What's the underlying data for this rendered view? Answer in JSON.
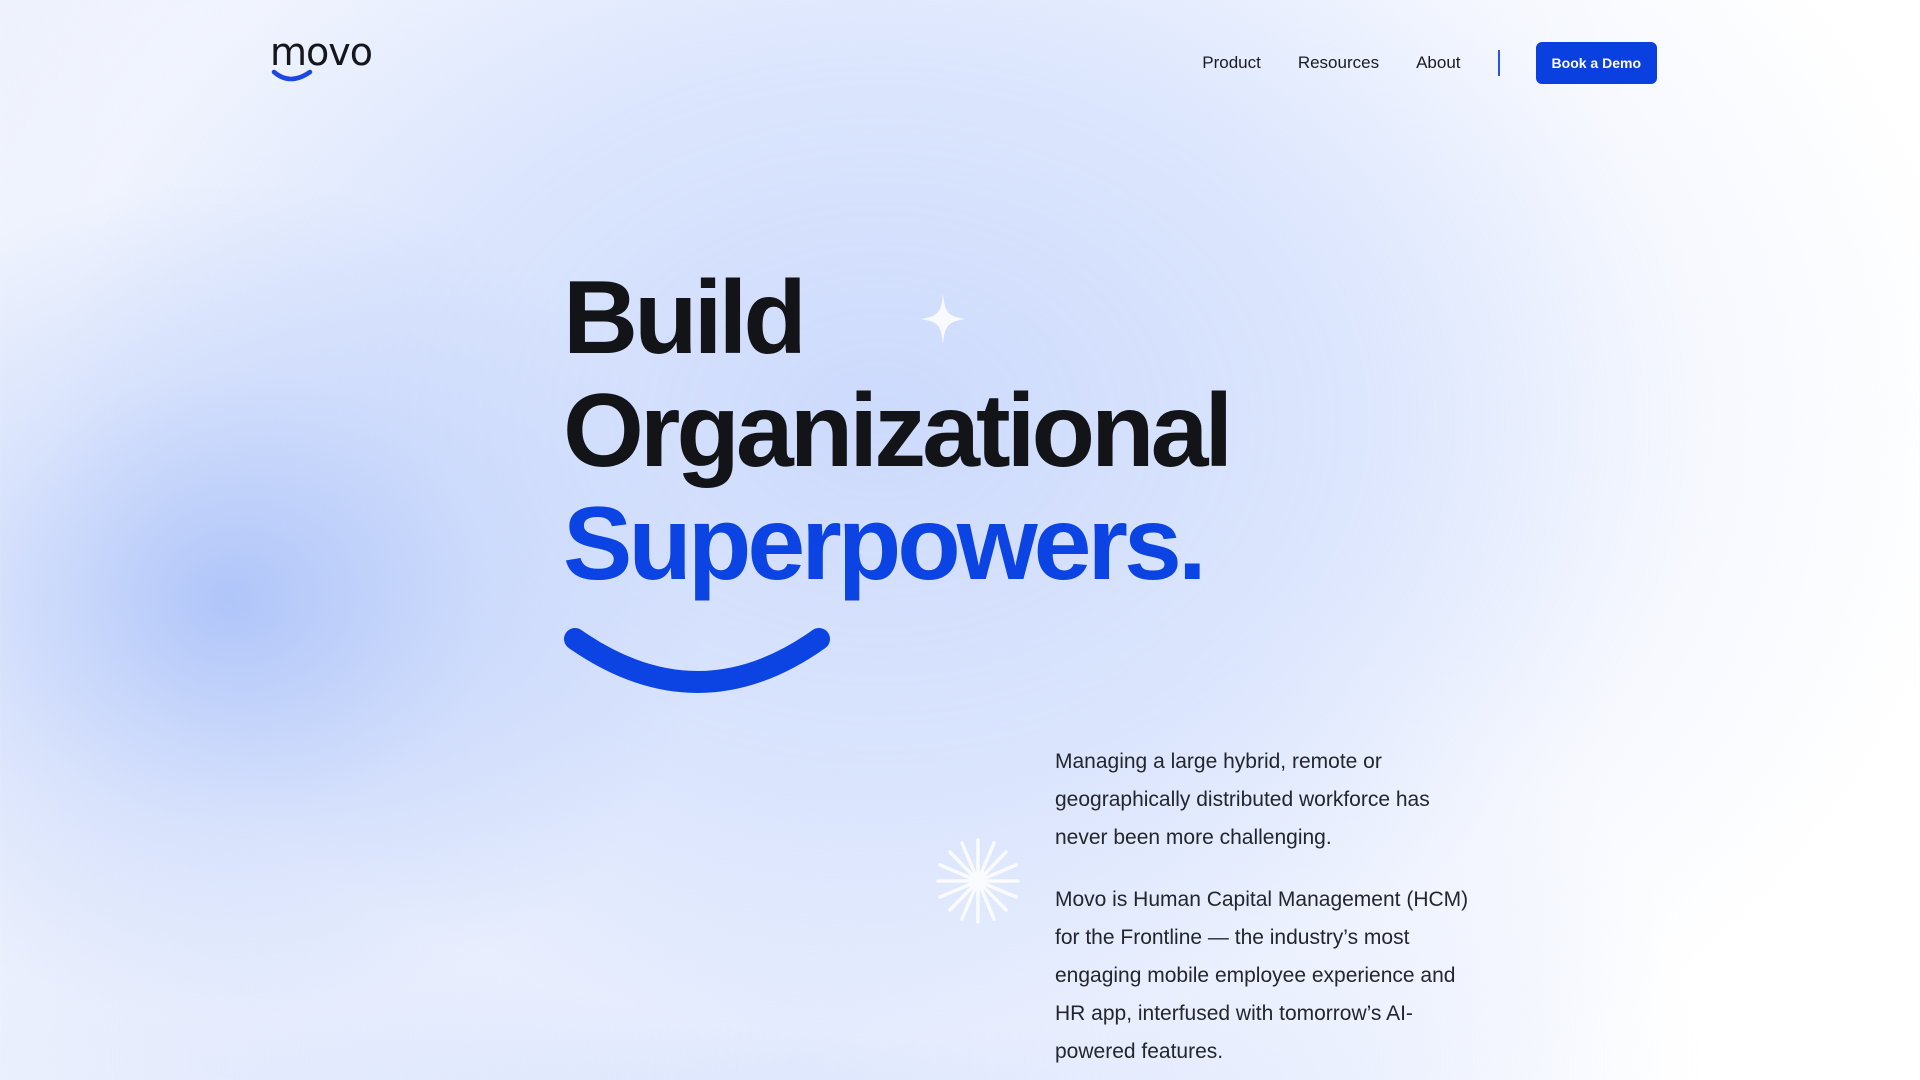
{
  "brand": {
    "name": "movo",
    "accent_color": "#0A3FE0"
  },
  "nav": {
    "items": [
      {
        "label": "Product"
      },
      {
        "label": "Resources"
      },
      {
        "label": "About"
      }
    ],
    "cta_label": "Book a Demo"
  },
  "hero": {
    "line1": "Build",
    "line2": "Organizational",
    "line3": "Superpowers."
  },
  "description": {
    "p1": "Managing a large hybrid, remote or geographically distributed workforce has never been more challenging.",
    "p2": "Movo is Human Capital Management (HCM) for the Frontline — the industry’s most engaging mobile employee experience and HR app, interfused with tomorrow’s AI-powered features."
  },
  "decor": {
    "sparkle_icon": "four-point-star-icon",
    "burst_icon": "starburst-icon",
    "smile_icon": "smile-arc-icon"
  }
}
